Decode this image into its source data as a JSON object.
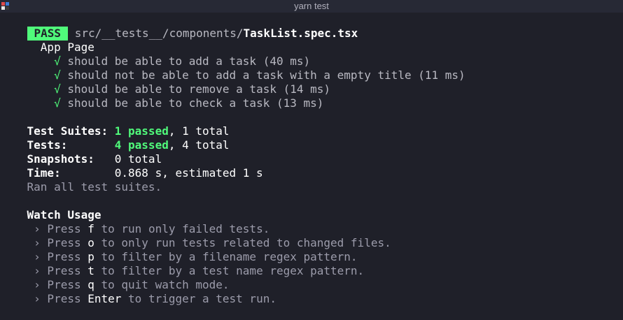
{
  "window": {
    "title": "yarn test",
    "icon": "terminal-app-icon",
    "accent_colors": [
      "#e04b4b",
      "#3b7bd6",
      "#e6e6e6",
      "#2d2d2d"
    ]
  },
  "result": {
    "badge": "PASS",
    "path_prefix": "src/__tests__/components/",
    "file": "TaskList.spec.tsx",
    "suite": "App Page",
    "check": "√",
    "tests": [
      "should be able to add a task (40 ms)",
      "should not be able to add a task with a empty title (11 ms)",
      "should be able to remove a task (14 ms)",
      "should be able to check a task (13 ms)"
    ]
  },
  "summary": {
    "suites_label": "Test Suites: ",
    "suites_passed": "1 passed",
    "suites_rest": ", 1 total",
    "tests_label": "Tests:       ",
    "tests_passed": "4 passed",
    "tests_rest": ", 4 total",
    "snapshots_label": "Snapshots:   ",
    "snapshots_value": "0 total",
    "time_label": "Time:        ",
    "time_value": "0.868 s, estimated 1 s",
    "ran": "Ran all test suites."
  },
  "watch": {
    "heading": "Watch Usage",
    "arrow": " › Press ",
    "items": [
      {
        "key": "f",
        "text": " to run only failed tests."
      },
      {
        "key": "o",
        "text": " to only run tests related to changed files."
      },
      {
        "key": "p",
        "text": " to filter by a filename regex pattern."
      },
      {
        "key": "t",
        "text": " to filter by a test name regex pattern."
      },
      {
        "key": "q",
        "text": " to quit watch mode."
      },
      {
        "key": "Enter",
        "text": " to trigger a test run."
      }
    ]
  },
  "colors": {
    "background": "#1f2029",
    "pass_green": "#50fa7b",
    "text": "#e6e6e6"
  }
}
